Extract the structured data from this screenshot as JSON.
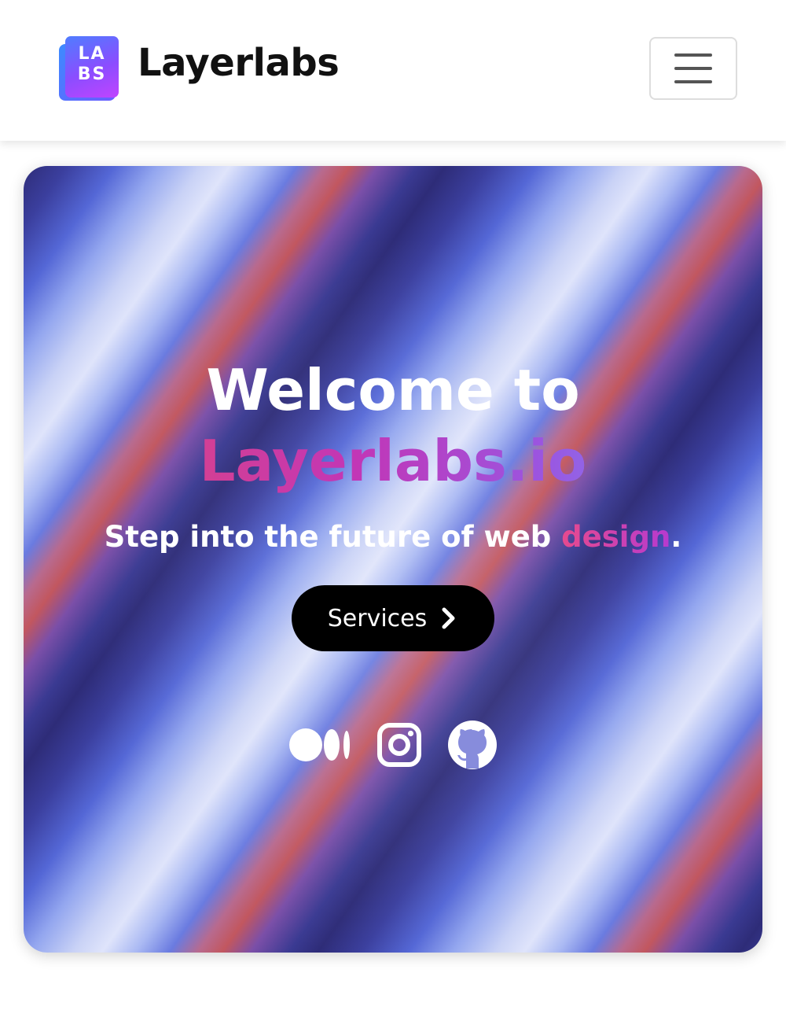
{
  "navbar": {
    "logo_text_top": "LA",
    "logo_text_bottom": "BS",
    "brand_name": "Layerlabs",
    "menu_toggle_icon": "hamburger-icon"
  },
  "hero": {
    "title_line1": "Welcome to",
    "title_line2": "Layerlabs.io",
    "subtitle_prefix": "Step into the future of web ",
    "subtitle_accent": "design",
    "subtitle_suffix": ".",
    "cta_label": "Services",
    "cta_icon": "chevron-right-icon",
    "socials": [
      {
        "icon": "medium-icon"
      },
      {
        "icon": "instagram-icon"
      },
      {
        "icon": "github-icon"
      }
    ]
  },
  "colors": {
    "accent_gradient_start": "#e64a6e",
    "accent_gradient_mid": "#c236b6",
    "accent_gradient_end": "#6f9bff",
    "button_bg": "#000000",
    "text_light": "#ffffff",
    "brand_text": "#111111"
  }
}
